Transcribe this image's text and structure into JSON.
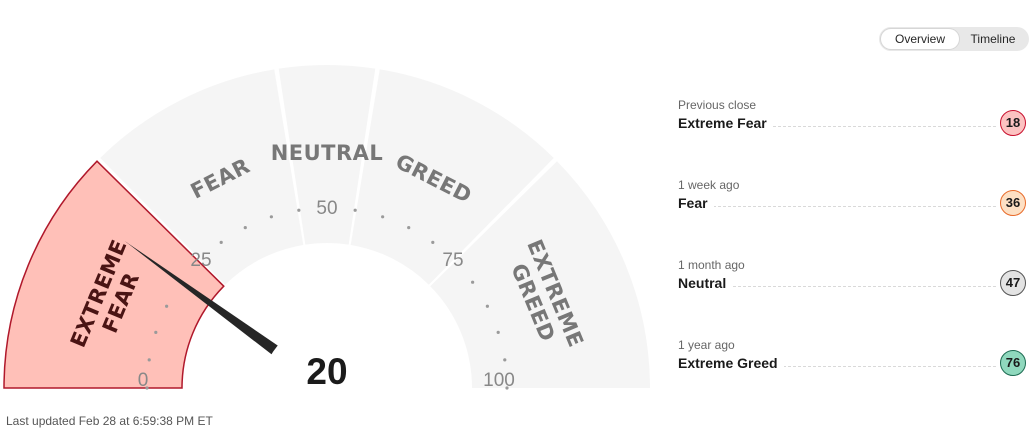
{
  "view_toggle": {
    "options": [
      "Overview",
      "Timeline"
    ],
    "selected": "Overview"
  },
  "gauge": {
    "value": 20,
    "rating": "Extreme Fear",
    "zones": [
      {
        "label_lines": [
          "EXTREME",
          "FEAR"
        ],
        "from": 0,
        "to": 25,
        "active": true
      },
      {
        "label_lines": [
          "FEAR"
        ],
        "from": 25,
        "to": 45,
        "active": false
      },
      {
        "label_lines": [
          "NEUTRAL"
        ],
        "from": 45,
        "to": 55,
        "active": false
      },
      {
        "label_lines": [
          "GREED"
        ],
        "from": 55,
        "to": 75,
        "active": false
      },
      {
        "label_lines": [
          "EXTREME",
          "GREED"
        ],
        "from": 75,
        "to": 100,
        "active": false
      }
    ],
    "scale_labels": [
      "0",
      "25",
      "50",
      "75",
      "100"
    ],
    "colors": {
      "active_fill": "#ffc0b8",
      "active_border": "#b0182b",
      "inactive_fill": "#f5f5f5",
      "needle": "#262626"
    }
  },
  "history": [
    {
      "period": "Previous close",
      "rating": "Extreme Fear",
      "value": "18",
      "color": "#fcc2c1",
      "border": "#c8102e"
    },
    {
      "period": "1 week ago",
      "rating": "Fear",
      "value": "36",
      "color": "#fde0c4",
      "border": "#e86b2a"
    },
    {
      "period": "1 month ago",
      "rating": "Neutral",
      "value": "47",
      "color": "#e3e3e3",
      "border": "#555555"
    },
    {
      "period": "1 year ago",
      "rating": "Extreme Greed",
      "value": "76",
      "color": "#8fd8bd",
      "border": "#1d6b52"
    }
  ],
  "last_updated": "Last updated Feb 28 at 6:59:38 PM ET"
}
